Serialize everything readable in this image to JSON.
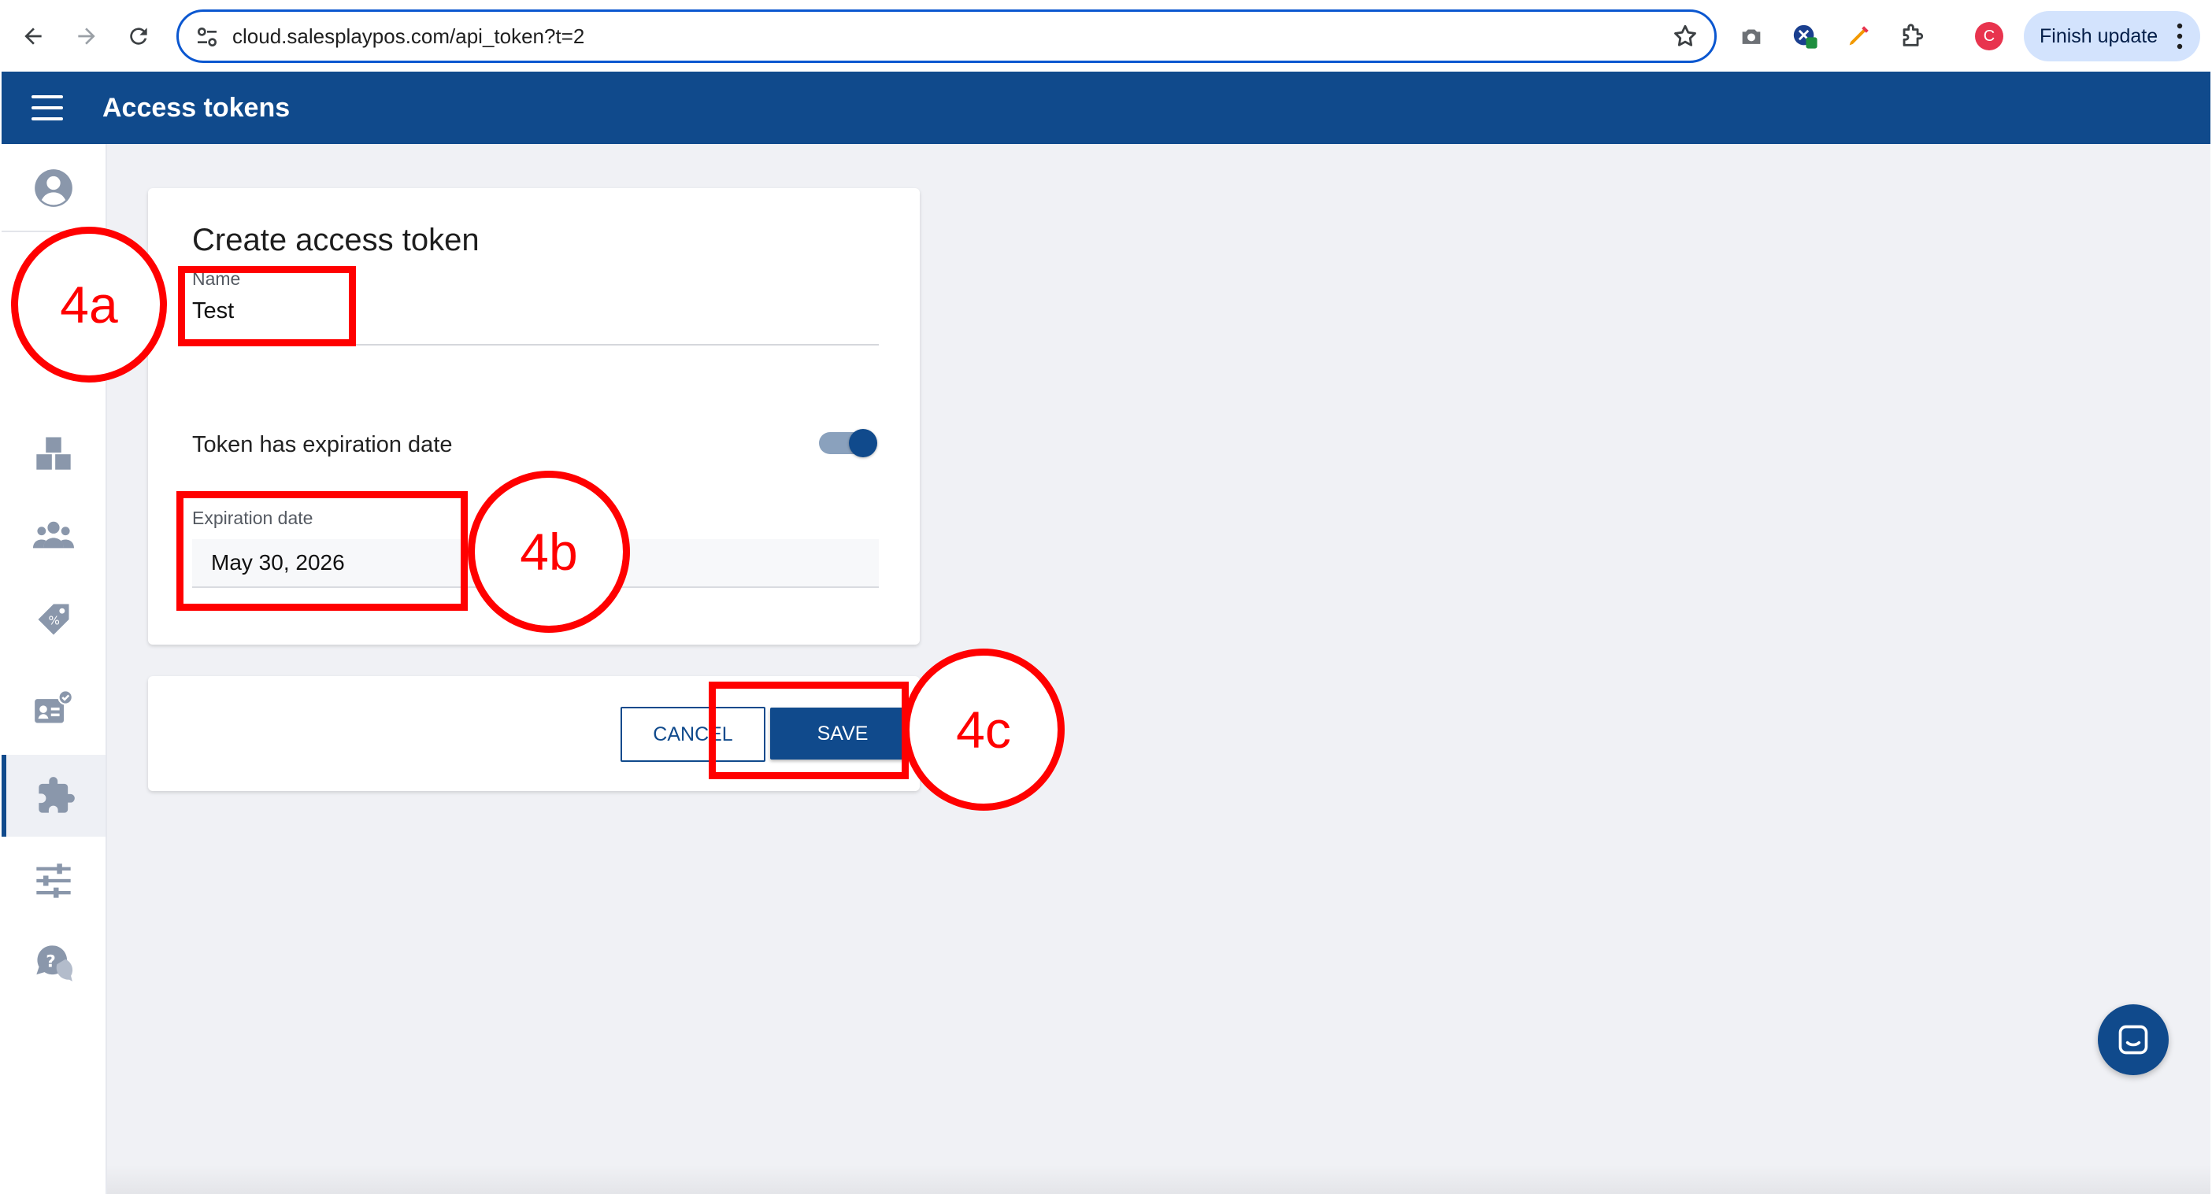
{
  "browser": {
    "url": "cloud.salesplaypos.com/api_token?t=2",
    "profile_initial": "C",
    "finish_update_label": "Finish update",
    "icons": [
      "back-arrow-icon",
      "forward-arrow-icon",
      "reload-icon",
      "site-settings-icon",
      "bookmark-star-icon",
      "camera-icon",
      "extension-blue-icon",
      "extension-pen-icon",
      "puzzle-extensions-icon",
      "kebab-menu-icon"
    ]
  },
  "appbar": {
    "title": "Access tokens"
  },
  "sidebar": {
    "items": [
      "account-circle-icon",
      "inventory-boxes-icon",
      "customers-group-icon",
      "discount-tag-icon",
      "employee-card-icon",
      "integrations-puzzle-icon",
      "settings-sliders-icon",
      "help-chat-icon"
    ],
    "active": "integrations-puzzle-icon"
  },
  "form": {
    "title": "Create access token",
    "name_label": "Name",
    "name_value": "Test",
    "expiration_toggle_label": "Token has expiration date",
    "expiration_toggle_on": true,
    "expiration_label": "Expiration date",
    "expiration_value": "May 30, 2026"
  },
  "actions": {
    "cancel_label": "CANCEL",
    "save_label": "SAVE"
  },
  "annotations": {
    "step_a": "4a",
    "step_b": "4b",
    "step_c": "4c",
    "color": "#ff0000"
  },
  "colors": {
    "brand": "#104a8c",
    "background": "#f0f1f5"
  }
}
